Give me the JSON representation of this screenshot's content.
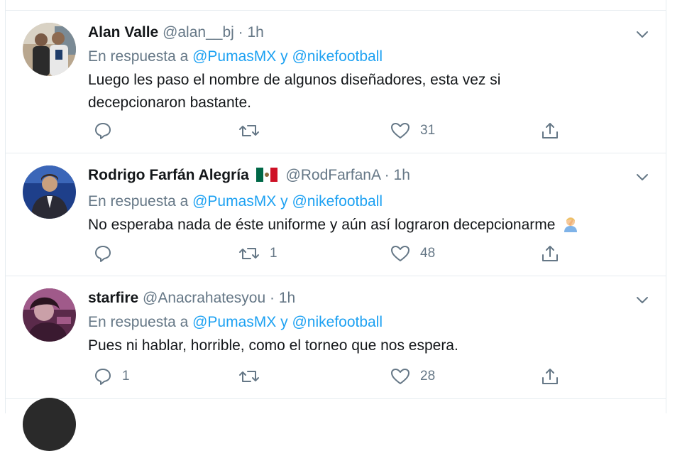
{
  "tweets": [
    {
      "name": "Alan Valle",
      "handle": "@alan__bj",
      "dot": "·",
      "time": "1h",
      "reply_prefix": "En respuesta a",
      "mention1": "@PumasMX",
      "conj": "y",
      "mention2": "@nikefootball",
      "text_line1": "Luego les paso el nombre de algunos diseñadores, esta vez si",
      "text_line2": "decepcionaron bastante.",
      "replies": "",
      "retweets": "",
      "likes": "31"
    },
    {
      "name": "Rodrigo Farfán Alegría",
      "flag_icon": "mexico-flag-icon",
      "handle": "@RodFarfanA",
      "dot": "·",
      "time": "1h",
      "reply_prefix": "En respuesta a",
      "mention1": "@PumasMX",
      "conj": "y",
      "mention2": "@nikefootball",
      "text_line1": "No esperaba nada de éste uniforme y aún así lograron decepcionarme",
      "emoji_icon": "facepalm-emoji-icon",
      "replies": "",
      "retweets": "1",
      "likes": "48"
    },
    {
      "name": "starfire",
      "handle": "@Anacrahatesyou",
      "dot": "·",
      "time": "1h",
      "reply_prefix": "En respuesta a",
      "mention1": "@PumasMX",
      "conj": "y",
      "mention2": "@nikefootball",
      "text_line1": "Pues ni hablar, horrible, como el torneo que nos espera.",
      "replies": "1",
      "retweets": "",
      "likes": "28"
    }
  ],
  "colors": {
    "accent": "#1da1f2",
    "secondary_text": "#657786",
    "border": "#e6ecf0"
  },
  "icons": [
    "reply-icon",
    "retweet-icon",
    "like-icon",
    "share-icon",
    "chevron-down-icon"
  ]
}
